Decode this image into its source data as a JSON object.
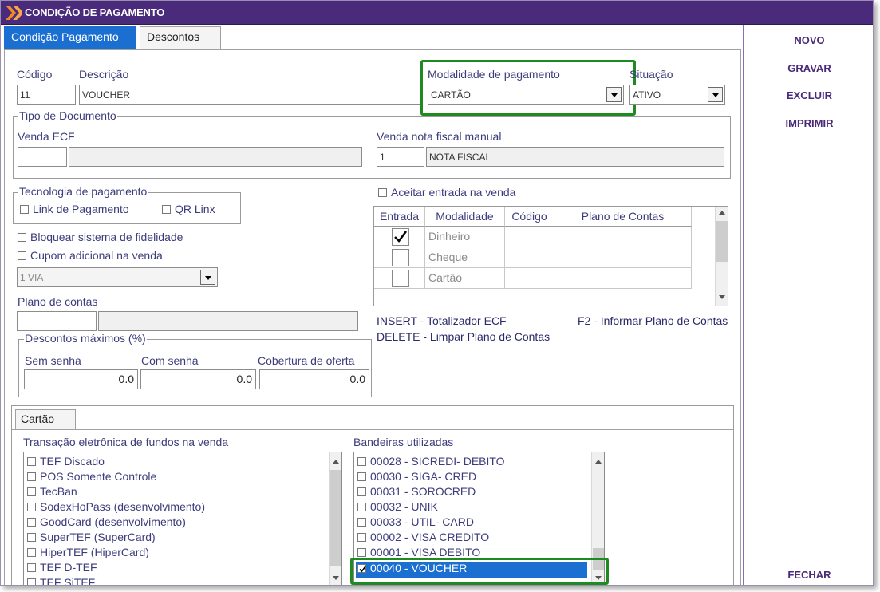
{
  "window": {
    "title": "CONDIÇÃO DE PAGAMENTO",
    "brand_color": "#4a2a7a",
    "accent_color": "#1a6fd1",
    "highlight_color": "#1f8a1f"
  },
  "tabs": [
    "Condição Pagamento",
    "Descontos"
  ],
  "actions": {
    "novo": "NOVO",
    "gravar": "GRAVAR",
    "excluir": "EXCLUIR",
    "imprimir": "IMPRIMIR",
    "fechar": "FECHAR"
  },
  "fields": {
    "codigo_label": "Código",
    "codigo_value": "11",
    "descricao_label": "Descrição",
    "descricao_value": "VOUCHER",
    "modalidade_label": "Modalidade de pagamento",
    "modalidade_value": "CARTÃO",
    "situacao_label": "Situação",
    "situacao_value": "ATIVO"
  },
  "tipo_documento": {
    "title": "Tipo de Documento",
    "venda_ecf_label": "Venda ECF",
    "venda_ecf_code": "",
    "venda_ecf_desc": "",
    "venda_nf_label": "Venda nota fiscal manual",
    "venda_nf_code": "1",
    "venda_nf_desc": "NOTA FISCAL"
  },
  "tecnologia": {
    "title": "Tecnologia de pagamento",
    "link": "Link de Pagamento",
    "qr": "QR Linx"
  },
  "bloquear_fidelidade": "Bloquear sistema de fidelidade",
  "cupom_adicional": "Cupom adicional na venda",
  "cupom_via": "1 VIA",
  "plano_contas": {
    "label": "Plano de contas",
    "code": "",
    "desc": ""
  },
  "descontos_max": {
    "title": "Descontos máximos (%)",
    "sem_senha_label": "Sem senha",
    "sem_senha": "0.0",
    "com_senha_label": "Com senha",
    "com_senha": "0.0",
    "cobertura_label": "Cobertura de oferta",
    "cobertura": "0.0"
  },
  "aceitar_entrada": "Aceitar entrada na venda",
  "entrada_grid": {
    "headers": [
      "Entrada",
      "Modalidade",
      "Código",
      "Plano de Contas"
    ],
    "rows": [
      {
        "checked": true,
        "modalidade": "Dinheiro",
        "codigo": "",
        "plano": ""
      },
      {
        "checked": false,
        "modalidade": "Cheque",
        "codigo": "",
        "plano": ""
      },
      {
        "checked": false,
        "modalidade": "Cartão",
        "codigo": "",
        "plano": ""
      }
    ]
  },
  "hints": {
    "insert": "INSERT - Totalizador ECF",
    "delete": "DELETE - Limpar Plano de Contas",
    "f2": "F2 - Informar Plano de Contas"
  },
  "cartao_tab": "Cartão",
  "tef": {
    "label": "Transação eletrônica de fundos na venda",
    "items": [
      "TEF Discado",
      "POS Somente Controle",
      "TecBan",
      "SodexHoPass (desenvolvimento)",
      "GoodCard (desenvolvimento)",
      "SuperTEF (SuperCard)",
      "HiperTEF (HiperCard)",
      "TEF D-TEF",
      "TEF SiTEF"
    ]
  },
  "bandeiras": {
    "label": "Bandeiras utilizadas",
    "items": [
      "00028 - SICREDI- DEBITO",
      "00030 - SIGA- CRED",
      "00031 - SOROCRED",
      "00032 - UNIK",
      "00033 - UTIL- CARD",
      "00002 - VISA CREDITO",
      "00001 - VISA DEBITO",
      "00040 - VOUCHER"
    ],
    "selected_index": 7
  }
}
